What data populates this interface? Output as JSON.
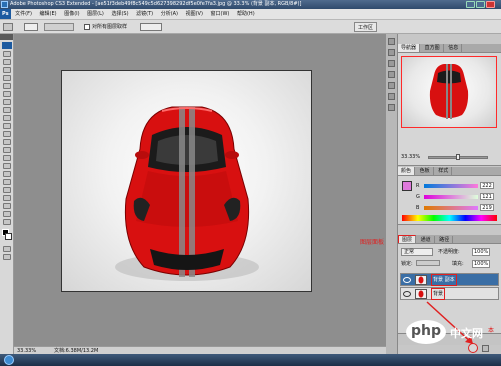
{
  "window": {
    "title": "Adobe Photoshop CS3 Extended - [ae51f3deb49f8c549c5d627398292df5e0fe7fa3.jpg @ 33.3% (背景 副本, RGB/8#)]"
  },
  "menu": [
    "文件(F)",
    "编辑(E)",
    "图像(I)",
    "图层(L)",
    "选择(S)",
    "滤镜(T)",
    "分析(A)",
    "视图(V)",
    "窗口(W)",
    "帮助(H)"
  ],
  "options": {
    "checkbox_label": "对所有图层取样",
    "right_label": "工作区"
  },
  "status": {
    "zoom": "33.33%",
    "doc": "文档:6.38M/13.2M"
  },
  "navigator": {
    "tabs": [
      "导航器",
      "直方图",
      "信息"
    ],
    "zoom": "33.33%"
  },
  "color": {
    "tabs": [
      "颜色",
      "色板",
      "样式"
    ],
    "r": "222",
    "g": "121",
    "b": "219"
  },
  "layers": {
    "tabs": [
      "图层",
      "通道",
      "路径"
    ],
    "blend_mode": "正常",
    "opacity_label": "不透明度:",
    "opacity": "100%",
    "lock_label": "锁定:",
    "fill_label": "填充:",
    "fill": "100%",
    "items": [
      {
        "name": "背景 副本"
      },
      {
        "name": "背景"
      }
    ]
  },
  "annotations": {
    "panel_label": "图层面板",
    "right_label": "本"
  },
  "watermark": {
    "php": "php",
    "site": "中文网"
  },
  "colors": {
    "car_red": "#d81010",
    "annotation_red": "#e02020",
    "panel_gray": "#d4d4d4"
  }
}
